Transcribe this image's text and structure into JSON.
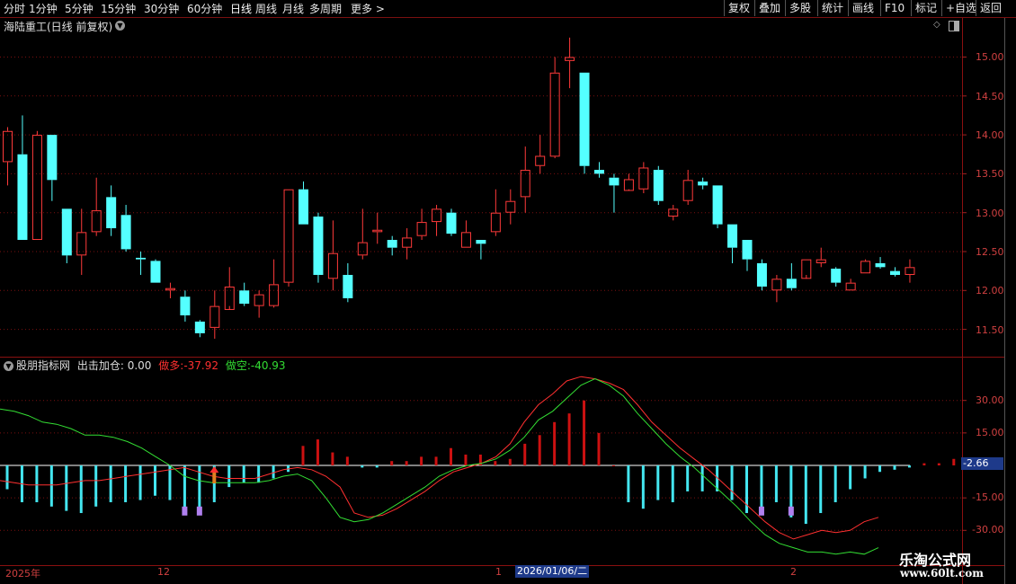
{
  "toolbar": {
    "periods": [
      "分时",
      "1分钟",
      "5分钟",
      "15分钟",
      "30分钟",
      "60分钟",
      "日线",
      "周线",
      "月线",
      "多周期",
      "更多 >"
    ],
    "buttons": [
      "复权",
      "叠加",
      "多股",
      "统计",
      "画线",
      "F10",
      "标记",
      "+自选",
      "返回"
    ]
  },
  "chart": {
    "title": "海陆重工(日线 前复权)",
    "price_axis": [
      "15.00",
      "14.50",
      "14.00",
      "13.50",
      "13.00",
      "12.50",
      "12.00",
      "11.50"
    ],
    "indicator": {
      "name": "股朋指标网",
      "signal_label": "出击加仓:",
      "signal_value": "0.00",
      "long_label": "做多:",
      "long_value": "-37.92",
      "short_label": "做空:",
      "short_value": "-40.93",
      "axis": [
        "30.00",
        "15.00",
        "-15.00",
        "-30.00"
      ],
      "current": "-2.66"
    },
    "dates": {
      "year": "2025年",
      "m12": "12",
      "m1": "1",
      "highlight": "2026/01/06/二",
      "m2": "2"
    }
  },
  "watermark": {
    "name": "乐淘公式网",
    "url": "www.60lt.com"
  },
  "colors": {
    "up": "#ff3a3a",
    "down": "#54ffff",
    "long": "#ff3030",
    "short": "#33dd33",
    "hist_pos": "#cc1111",
    "hist_neg": "#44e6f0",
    "marker": "#b080ee"
  },
  "chart_data": [
    {
      "type": "candlestick",
      "title": "海陆重工(日线 前复权)",
      "ylim": [
        11.3,
        15.3
      ],
      "candles": [
        [
          13.65,
          14.05,
          13.35,
          14.1
        ],
        [
          13.75,
          12.65,
          12.65,
          14.25
        ],
        [
          12.65,
          14.0,
          12.65,
          14.05
        ],
        [
          14.0,
          13.42,
          13.15,
          14.0
        ],
        [
          13.05,
          12.45,
          12.35,
          13.05
        ],
        [
          12.45,
          12.75,
          12.2,
          13.05
        ],
        [
          12.75,
          13.03,
          12.7,
          13.45
        ],
        [
          13.2,
          12.8,
          12.7,
          13.35
        ],
        [
          12.97,
          12.53,
          12.5,
          13.1
        ],
        [
          12.42,
          12.4,
          12.2,
          12.5
        ],
        [
          12.38,
          12.1,
          12.1,
          12.4
        ],
        [
          12.0,
          12.03,
          11.9,
          12.1
        ],
        [
          11.92,
          11.68,
          11.6,
          12.0
        ],
        [
          11.6,
          11.45,
          11.4,
          11.62
        ],
        [
          11.52,
          11.8,
          11.38,
          12.0
        ],
        [
          11.75,
          12.05,
          11.8,
          12.3
        ],
        [
          12.0,
          11.83,
          11.8,
          12.1
        ],
        [
          11.8,
          11.95,
          11.65,
          12.0
        ],
        [
          11.8,
          12.08,
          11.78,
          12.4
        ],
        [
          12.1,
          13.3,
          12.05,
          13.3
        ],
        [
          13.3,
          12.85,
          12.85,
          13.4
        ],
        [
          12.95,
          12.2,
          12.1,
          13.0
        ],
        [
          12.15,
          12.48,
          12.0,
          12.9
        ],
        [
          12.2,
          11.9,
          11.85,
          12.35
        ],
        [
          12.45,
          12.62,
          12.4,
          13.05
        ],
        [
          12.75,
          12.78,
          12.6,
          13.0
        ],
        [
          12.65,
          12.55,
          12.45,
          12.7
        ],
        [
          12.55,
          12.68,
          12.4,
          12.8
        ],
        [
          12.7,
          12.88,
          12.65,
          13.05
        ],
        [
          12.88,
          13.05,
          12.7,
          13.1
        ],
        [
          13.0,
          12.73,
          12.7,
          13.05
        ],
        [
          12.55,
          12.75,
          12.55,
          12.9
        ],
        [
          12.65,
          12.6,
          12.4,
          12.65
        ],
        [
          12.75,
          13.0,
          12.7,
          13.3
        ],
        [
          13.0,
          13.15,
          12.85,
          13.3
        ],
        [
          13.2,
          13.55,
          13.0,
          13.85
        ],
        [
          13.6,
          13.73,
          13.5,
          14.0
        ],
        [
          13.72,
          14.8,
          13.7,
          15.0
        ],
        [
          14.95,
          15.0,
          14.6,
          15.25
        ],
        [
          14.8,
          13.6,
          13.5,
          14.8
        ],
        [
          13.55,
          13.5,
          13.45,
          13.65
        ],
        [
          13.45,
          13.35,
          13.0,
          13.5
        ],
        [
          13.28,
          13.43,
          13.3,
          13.5
        ],
        [
          13.3,
          13.58,
          13.25,
          13.65
        ],
        [
          13.55,
          13.15,
          13.1,
          13.6
        ],
        [
          12.95,
          13.05,
          12.9,
          13.1
        ],
        [
          13.15,
          13.42,
          13.1,
          13.55
        ],
        [
          13.4,
          13.35,
          13.3,
          13.45
        ],
        [
          13.35,
          12.85,
          12.8,
          13.35
        ],
        [
          12.85,
          12.55,
          12.35,
          12.85
        ],
        [
          12.65,
          12.4,
          12.25,
          12.65
        ],
        [
          12.35,
          12.05,
          12.0,
          12.4
        ],
        [
          12.0,
          12.15,
          11.85,
          12.2
        ],
        [
          12.15,
          12.03,
          12.0,
          12.35
        ],
        [
          12.15,
          12.4,
          12.2,
          12.4
        ],
        [
          12.35,
          12.4,
          12.3,
          12.55
        ],
        [
          12.28,
          12.1,
          12.05,
          12.3
        ],
        [
          12.0,
          12.1,
          12.0,
          12.15
        ],
        [
          12.22,
          12.38,
          12.22,
          12.4
        ],
        [
          12.35,
          12.3,
          12.28,
          12.43
        ],
        [
          12.25,
          12.2,
          12.18,
          12.3
        ],
        [
          12.2,
          12.3,
          12.1,
          12.4
        ]
      ]
    },
    {
      "type": "line",
      "title": "股朋指标网",
      "ylim": [
        -35,
        42
      ],
      "series": [
        {
          "name": "做多",
          "values": [
            -7,
            -8,
            -9,
            -9,
            -9,
            -8,
            -7,
            -7,
            -6,
            -5,
            -4,
            -3,
            -2,
            -1,
            -3,
            -5,
            -6,
            -6,
            -6,
            -4,
            -2,
            -1,
            -2,
            -5,
            -10,
            -22,
            -24,
            -23,
            -20,
            -16,
            -12,
            -7,
            -3,
            -1,
            1,
            4,
            10,
            20,
            28,
            33,
            39,
            41,
            40,
            38,
            35,
            28,
            20,
            14,
            8,
            3,
            -2,
            -8,
            -14,
            -20,
            -26,
            -31,
            -34,
            -32,
            -30,
            -31,
            -30,
            -26,
            -24
          ]
        },
        {
          "name": "做空",
          "values": [
            26,
            25,
            23,
            20,
            19,
            17,
            14,
            14,
            13,
            11,
            8,
            4,
            0,
            -5,
            -7,
            -8,
            -8,
            -8,
            -8,
            -7,
            -5,
            -4,
            -7,
            -15,
            -24,
            -26,
            -25,
            -22,
            -18,
            -14,
            -10,
            -5,
            -2,
            0,
            1,
            3,
            7,
            13,
            21,
            25,
            31,
            37,
            40,
            37,
            32,
            24,
            17,
            10,
            4,
            -1,
            -7,
            -13,
            -19,
            -26,
            -32,
            -36,
            -38,
            -40,
            -40,
            -41,
            -40,
            -41,
            -38
          ]
        }
      ],
      "histogram": [
        -11,
        -17,
        -17,
        -19,
        -21,
        -22,
        -19,
        -17,
        -17,
        -16,
        -14,
        -16,
        -20,
        -22,
        -17,
        -10,
        -8,
        -8,
        -6,
        -3,
        9,
        12,
        6,
        4,
        -1,
        -1,
        2,
        2,
        4,
        4,
        8,
        5,
        5,
        2,
        3,
        10,
        14,
        20,
        24,
        30,
        15,
        0,
        -17,
        -20,
        -16,
        -17,
        -12,
        -12,
        -12,
        -16,
        -22,
        -21,
        -17,
        -24,
        -27,
        -22,
        -17,
        -11,
        -6,
        -3,
        -2,
        -1,
        1,
        1,
        3
      ]
    }
  ]
}
